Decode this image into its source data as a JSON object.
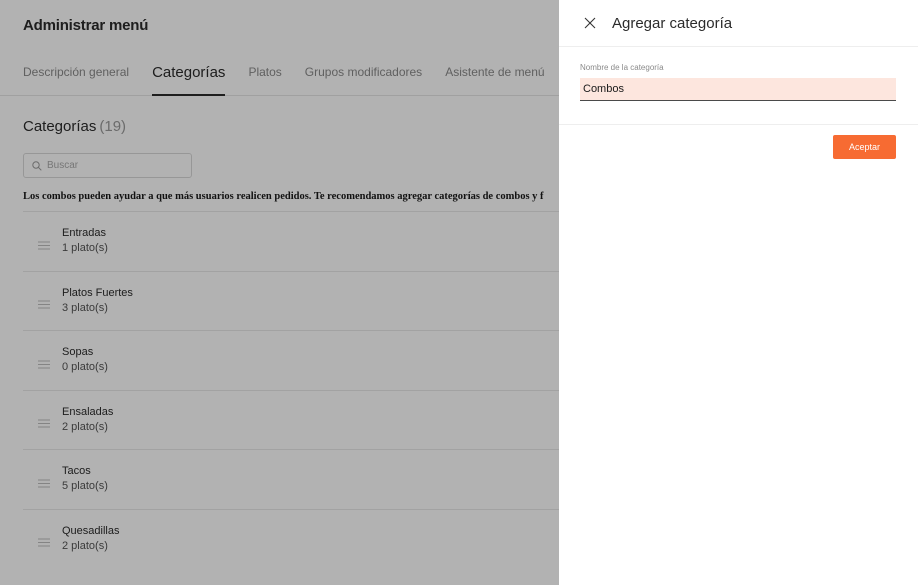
{
  "page": {
    "title": "Administrar menú",
    "tabs": [
      {
        "label": "Descripción general",
        "active": false
      },
      {
        "label": "Categorías",
        "active": true
      },
      {
        "label": "Platos",
        "active": false
      },
      {
        "label": "Grupos modificadores",
        "active": false
      },
      {
        "label": "Asistente de menú",
        "active": false
      }
    ],
    "section_title": "Categorías",
    "section_count": "(19)",
    "search": {
      "placeholder": "Buscar",
      "icon": "search-icon"
    },
    "notice": "Los combos pueden ayudar a que más usuarios realicen pedidos. Te recomendamos agregar categorías de combos y f",
    "categories": [
      {
        "name": "Entradas",
        "count": "1 plato(s)"
      },
      {
        "name": "Platos Fuertes",
        "count": "3 plato(s)"
      },
      {
        "name": "Sopas",
        "count": "0 plato(s)"
      },
      {
        "name": "Ensaladas",
        "count": "2 plato(s)"
      },
      {
        "name": "Tacos",
        "count": "5 plato(s)"
      },
      {
        "name": "Quesadillas",
        "count": "2 plato(s)"
      }
    ]
  },
  "drawer": {
    "title": "Agregar categoría",
    "close_icon": "close-icon",
    "field_label": "Nombre de la categoría",
    "field_value": "Combos",
    "accept_label": "Aceptar"
  },
  "colors": {
    "accent": "#f76b32",
    "field_background": "#fde6de",
    "overlay": "rgba(0,0,0,0.30)"
  }
}
